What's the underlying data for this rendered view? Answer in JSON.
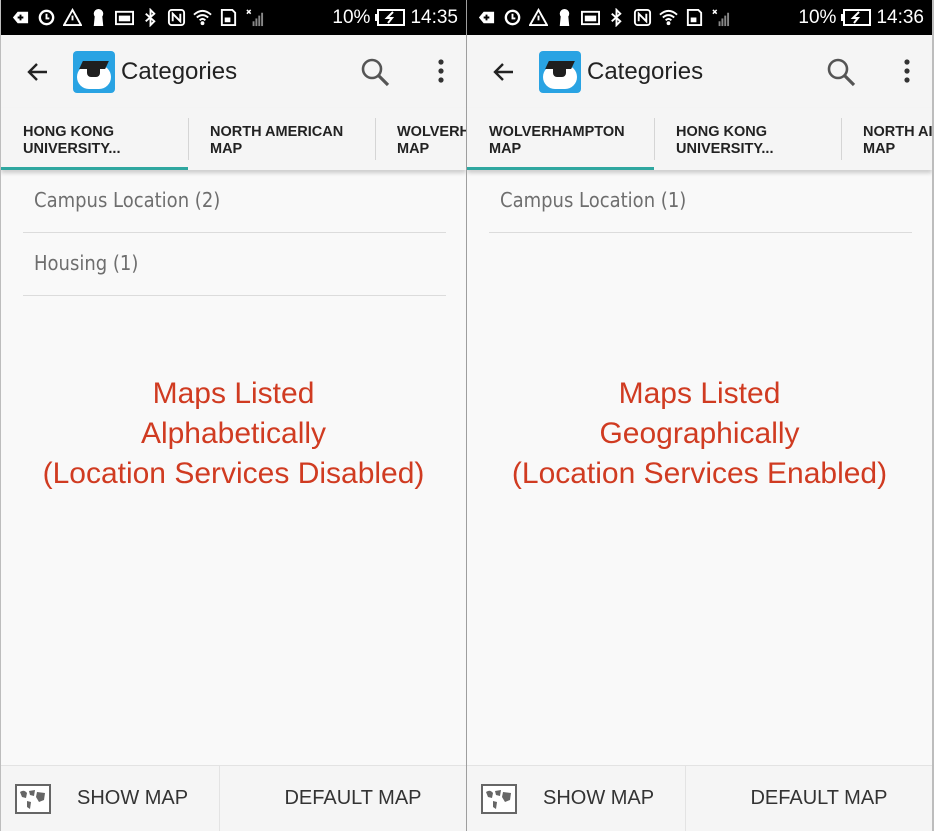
{
  "screens": [
    {
      "status": {
        "battery": "10%",
        "time": "14:35"
      },
      "appbar": {
        "title": "Categories"
      },
      "tabs": [
        {
          "line1": "HONG KONG",
          "line2": "UNIVERSITY..."
        },
        {
          "line1": "NORTH AMERICAN",
          "line2": "MAP"
        },
        {
          "line1": "WOLVERH",
          "line2": "MAP"
        }
      ],
      "active_tab": 0,
      "categories": [
        {
          "label": "Campus Location (2)"
        },
        {
          "label": "Housing (1)"
        }
      ],
      "annotation": {
        "line1": "Maps Listed",
        "line2": "Alphabetically",
        "line3": "(Location Services Disabled)"
      },
      "bottom": {
        "show_map": "SHOW MAP",
        "default_map": "DEFAULT MAP"
      }
    },
    {
      "status": {
        "battery": "10%",
        "time": "14:36"
      },
      "appbar": {
        "title": "Categories"
      },
      "tabs": [
        {
          "line1": "WOLVERHAMPTON",
          "line2": "MAP"
        },
        {
          "line1": "HONG KONG",
          "line2": "UNIVERSITY..."
        },
        {
          "line1": "NORTH AI",
          "line2": "MAP"
        }
      ],
      "active_tab": 0,
      "categories": [
        {
          "label": "Campus Location (1)"
        }
      ],
      "annotation": {
        "line1": "Maps Listed",
        "line2": "Geographically",
        "line3": "(Location Services Enabled)"
      },
      "bottom": {
        "show_map": "SHOW MAP",
        "default_map": "DEFAULT MAP"
      }
    }
  ],
  "colors": {
    "accent": "#2fa7a0",
    "annotation": "#d03b21",
    "app_icon": "#29a3e3"
  },
  "icons": [
    "back-arrow-icon",
    "app-logo-icon",
    "search-icon",
    "overflow-menu-icon",
    "world-map-icon"
  ]
}
